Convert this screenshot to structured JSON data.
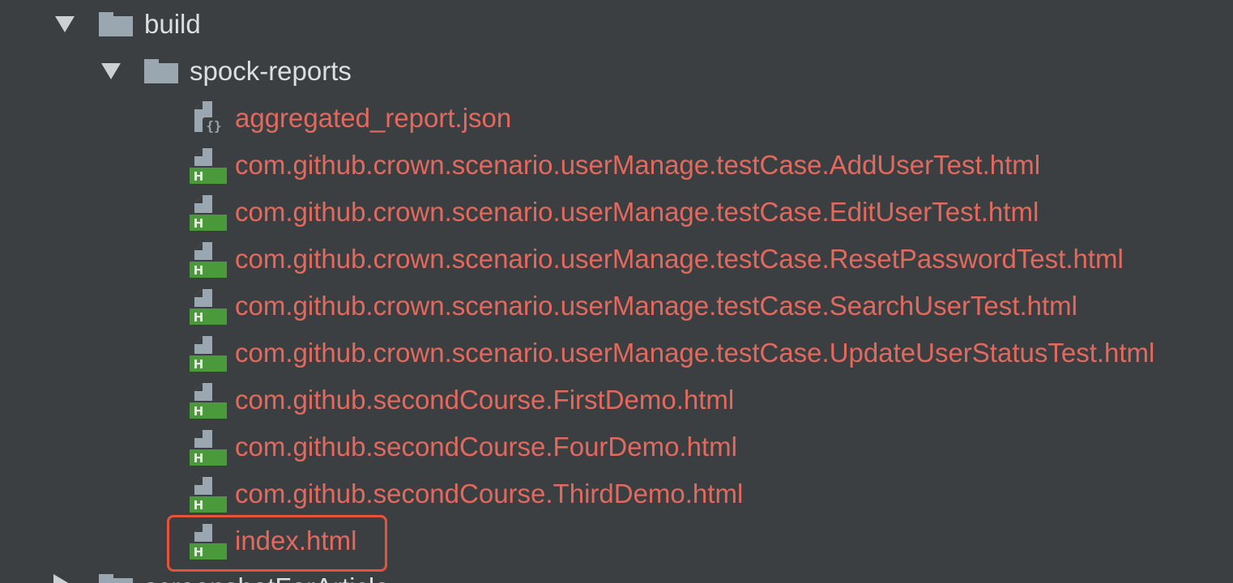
{
  "tree": {
    "root_folder": {
      "label": "build",
      "expanded": true,
      "icon": "folder-icon"
    },
    "sub_folder": {
      "label": "spock-reports",
      "expanded": true,
      "icon": "folder-icon"
    },
    "files": [
      {
        "label": "aggregated_report.json",
        "icon": "json-file-icon"
      },
      {
        "label": "com.github.crown.scenario.userManage.testCase.AddUserTest.html",
        "icon": "html-file-icon"
      },
      {
        "label": "com.github.crown.scenario.userManage.testCase.EditUserTest.html",
        "icon": "html-file-icon"
      },
      {
        "label": "com.github.crown.scenario.userManage.testCase.ResetPasswordTest.html",
        "icon": "html-file-icon"
      },
      {
        "label": "com.github.crown.scenario.userManage.testCase.SearchUserTest.html",
        "icon": "html-file-icon"
      },
      {
        "label": "com.github.crown.scenario.userManage.testCase.UpdateUserStatusTest.html",
        "icon": "html-file-icon"
      },
      {
        "label": "com.github.secondCourse.FirstDemo.html",
        "icon": "html-file-icon"
      },
      {
        "label": "com.github.secondCourse.FourDemo.html",
        "icon": "html-file-icon"
      },
      {
        "label": "com.github.secondCourse.ThirdDemo.html",
        "icon": "html-file-icon"
      },
      {
        "label": "index.html",
        "icon": "html-file-icon",
        "highlighted": true
      }
    ],
    "next_folder": {
      "label": "screenshotForArticle",
      "expanded": false,
      "icon": "folder-icon"
    }
  },
  "colors": {
    "background": "#3c3f41",
    "folder_text": "#dcdfe1",
    "file_text": "#e2695d",
    "html_badge": "#4a9a3c",
    "highlight_border": "#e5543a"
  }
}
